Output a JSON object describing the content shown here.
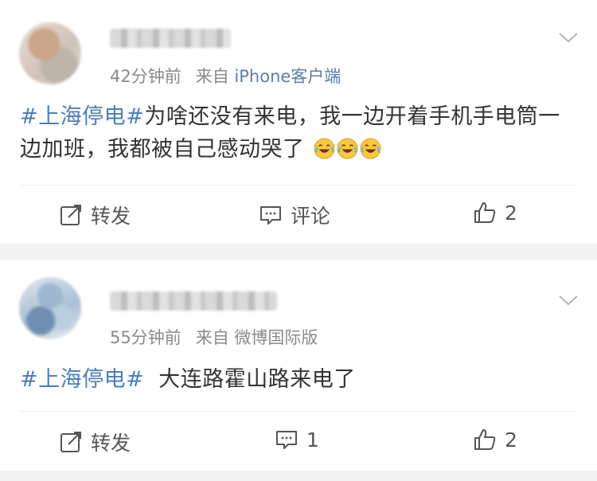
{
  "posts": [
    {
      "time_text": "42分钟前",
      "source_prefix": "来自",
      "source": "iPhone客户端",
      "hashtag": "#上海停电#",
      "text": "为啥还没有来电，我一边开着手机手电筒一边加班，我都被自己感动哭了",
      "emoji": [
        "laughing-tears-emoji",
        "laughing-tears-emoji",
        "laughing-tears-emoji"
      ],
      "actions": {
        "repost": "转发",
        "comment": "评论",
        "like": "2"
      }
    },
    {
      "time_text": "55分钟前",
      "source_prefix": "来自",
      "source": "微博国际版",
      "hashtag": "#上海停电#",
      "text": "大连路霍山路来电了",
      "actions": {
        "repost": "转发",
        "comment": "1",
        "like": "2"
      }
    }
  ],
  "colors": {
    "hashtag": "#4d7eb5",
    "source": "#5b7fa6",
    "meta": "#8a8a8a",
    "background": "#f2f2f2"
  },
  "icons": [
    "repost-icon",
    "comment-icon",
    "like-icon",
    "chevron-down-icon"
  ]
}
